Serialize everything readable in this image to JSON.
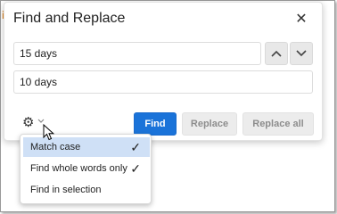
{
  "dialog": {
    "title": "Find and Replace",
    "close_icon": "close-icon"
  },
  "find": {
    "value": "15 days"
  },
  "replace": {
    "value": "10 days"
  },
  "buttons": {
    "find": "Find",
    "replace": "Replace",
    "replace_all": "Replace all"
  },
  "icons": {
    "prev": "chevron-up-icon",
    "next": "chevron-down-icon",
    "options": "gear-icon",
    "options_caret": "chevron-down-icon"
  },
  "options_menu": {
    "items": [
      {
        "label": "Match case",
        "checked": true,
        "highlighted": true
      },
      {
        "label": "Find whole words only",
        "checked": true,
        "highlighted": false
      },
      {
        "label": "Find in selection",
        "checked": false,
        "highlighted": false
      }
    ]
  },
  "colors": {
    "primary": "#1a73d9",
    "highlight": "#cfe0f6",
    "disabled_text": "#8d8d8d"
  }
}
